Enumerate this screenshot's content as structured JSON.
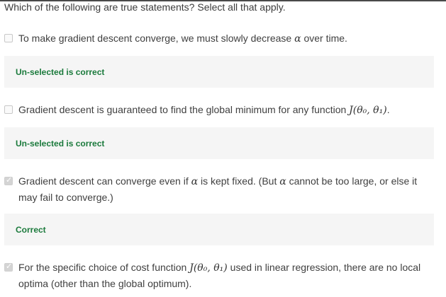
{
  "question": "Which of the following are true statements? Select all that apply.",
  "options": [
    {
      "pre": "To make gradient descent converge, we must slowly decrease ",
      "math": "α",
      "post": " over time.",
      "checked": false,
      "feedback": "Un-selected is correct"
    },
    {
      "pre": "Gradient descent is guaranteed to find the global minimum for any function ",
      "math": "J(θ₀, θ₁)",
      "post": ".",
      "checked": false,
      "feedback": "Un-selected is correct"
    },
    {
      "pre": "Gradient descent can converge even if ",
      "math": "α",
      "mid": " is kept fixed. (But ",
      "math2": "α",
      "post": " cannot be too large, or else it may fail to converge.)",
      "checked": true,
      "feedback": "Correct"
    },
    {
      "pre": "For the specific choice of cost function ",
      "math": "J(θ₀, θ₁)",
      "post": " used in linear regression, there are no local optima (other than the global optimum).",
      "checked": true
    }
  ],
  "colors": {
    "feedback_green": "#1b7a3c",
    "feedback_bg": "#f5f5f5"
  }
}
